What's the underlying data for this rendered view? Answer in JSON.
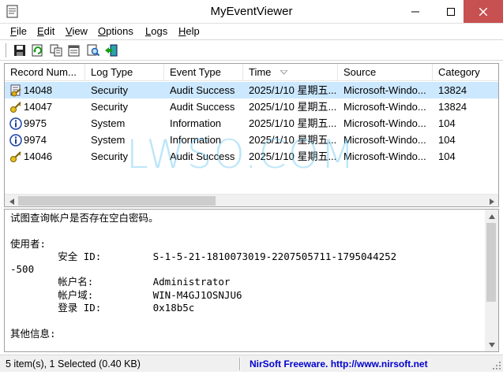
{
  "window": {
    "title": "MyEventViewer"
  },
  "menu": [
    {
      "key": "F",
      "rest": "ile"
    },
    {
      "key": "E",
      "rest": "dit"
    },
    {
      "key": "V",
      "rest": "iew"
    },
    {
      "key": "O",
      "rest": "ptions"
    },
    {
      "key": "L",
      "rest": "ogs"
    },
    {
      "key": "H",
      "rest": "elp"
    }
  ],
  "toolbar": [
    "save-icon",
    "refresh-icon",
    "copy-icon",
    "properties-icon",
    "find-icon",
    "exit-icon"
  ],
  "columns": [
    "Record Num...",
    "Log Type",
    "Event Type",
    "Time",
    "Source",
    "Category"
  ],
  "rows": [
    {
      "icon": "audit-success-icon",
      "record": "14048",
      "log_type": "Security",
      "event_type": "Audit Success",
      "time": "2025/1/10 星期五...",
      "source": "Microsoft-Windo...",
      "category": "13824",
      "selected": true
    },
    {
      "icon": "key-icon",
      "record": "14047",
      "log_type": "Security",
      "event_type": "Audit Success",
      "time": "2025/1/10 星期五...",
      "source": "Microsoft-Windo...",
      "category": "13824",
      "selected": false
    },
    {
      "icon": "info-icon",
      "record": "9975",
      "log_type": "System",
      "event_type": "Information",
      "time": "2025/1/10 星期五...",
      "source": "Microsoft-Windo...",
      "category": "104",
      "selected": false
    },
    {
      "icon": "info-icon",
      "record": "9974",
      "log_type": "System",
      "event_type": "Information",
      "time": "2025/1/10 星期五...",
      "source": "Microsoft-Windo...",
      "category": "104",
      "selected": false
    },
    {
      "icon": "key-icon",
      "record": "14046",
      "log_type": "Security",
      "event_type": "Audit Success",
      "time": "2025/1/10 星期五...",
      "source": "Microsoft-Windo...",
      "category": "104",
      "selected": false
    }
  ],
  "detail": {
    "text": "试图查询帐户是否存在空白密码。\n\n使用者:\n\t安全 ID:\t\tS-1-5-21-1810073019-2207505711-1795044252\n-500\n\t帐户名:\t\tAdministrator\n\t帐户域:\t\tWIN-M4GJ1OSNJU6\n\t登录 ID:\t\t0x18b5c\n\n其他信息:"
  },
  "status": {
    "left": "5 item(s), 1 Selected  (0.40 KB)",
    "right": "NirSoft Freeware.  http://www.nirsoft.net"
  },
  "watermark": "LWSO.COM",
  "colors": {
    "selection": "#cce8ff",
    "link": "#0000d0",
    "close": "#c75050"
  }
}
